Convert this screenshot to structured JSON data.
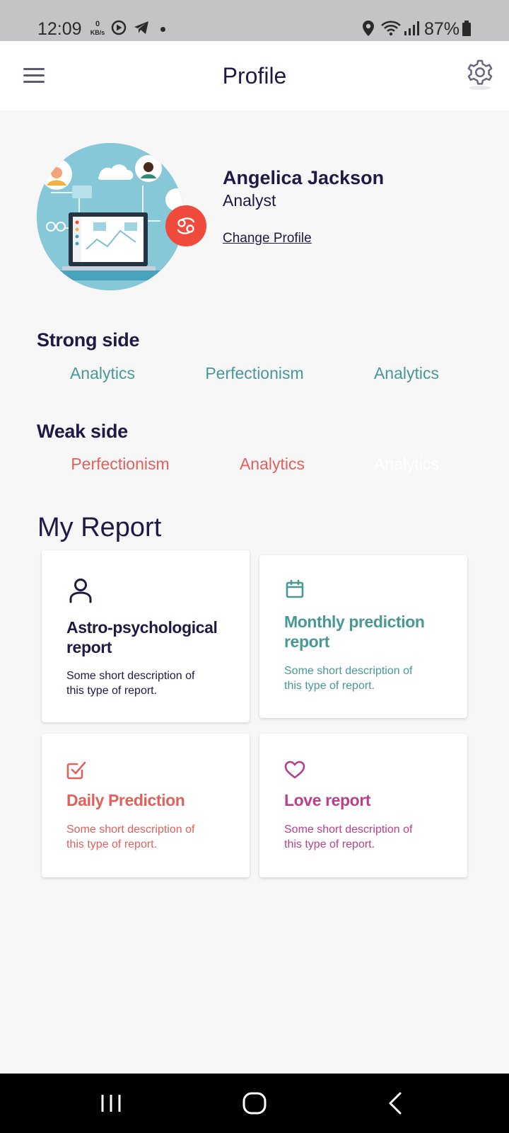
{
  "status_bar": {
    "time": "12:09",
    "speed_value": "0",
    "speed_unit": "KB/s",
    "battery": "87%",
    "icons": [
      "media-play-icon",
      "telegram-icon",
      "location-icon",
      "wifi-icon",
      "signal-icon",
      "battery-icon"
    ]
  },
  "app_bar": {
    "title": "Profile",
    "menu_icon": "hamburger-menu-icon",
    "settings_icon": "gear-icon"
  },
  "profile": {
    "name": "Angelica Jackson",
    "role": "Analyst",
    "change_link": "Change Profile",
    "sign_icon": "cancer-zodiac-icon",
    "colors": {
      "sign_badge": "#f04a3c"
    }
  },
  "strong_side": {
    "heading": "Strong side",
    "traits": [
      "Analytics",
      "Perfectionism",
      "Analytics"
    ],
    "color": "#4a9896"
  },
  "weak_side": {
    "heading": "Weak side",
    "traits": [
      "Perfectionism",
      "Analytics",
      "Analytics"
    ],
    "color": "#e0615a"
  },
  "reports": {
    "heading": "My Report",
    "cards": [
      {
        "title": "Astro-psychological report",
        "description": "Some short description of this type of report.",
        "icon": "person-icon",
        "color": "#1f1a45"
      },
      {
        "title": "Monthly prediction report",
        "description": "Some short description of this type of report.",
        "icon": "calendar-icon",
        "color": "#4a9896"
      },
      {
        "title": "Daily Prediction",
        "description": "Some short description of this type of report.",
        "icon": "checkbox-icon",
        "color": "#e0615a"
      },
      {
        "title": "Love report",
        "description": "Some short description of this type of report.",
        "icon": "heart-icon",
        "color": "#b8418b"
      }
    ]
  },
  "nav_bar": {
    "icons": [
      "recent-apps-icon",
      "home-icon",
      "back-icon"
    ]
  }
}
